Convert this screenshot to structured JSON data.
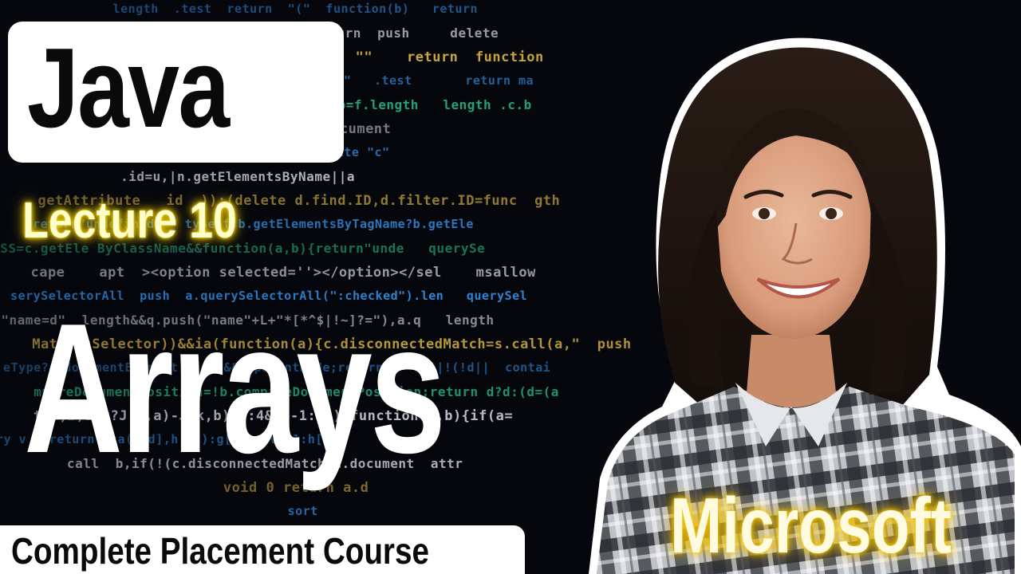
{
  "thumbnail": {
    "title": "Java",
    "lecture": "Lecture 10",
    "topic": "Arrays",
    "course": "Complete Placement Course",
    "company": "Microsoft"
  },
  "background": {
    "code_lines": [
      "                  length  .test  return  \"(\"  function(b)   return  ",
      "   },(                function  b  \"  return  push     delete  ",
      "                 split  \"(\"  length while  \"\"    return  function",
      "                 toLowerCase   return\"input\"   .test       return ma",
      "                   \"  \"  e      length  a,b=f.length   length .c.b",
      "                    var  b,e,g=a?a.ownerDocument    ",
      "                 className  \"i\" a.getAttribute \"c\"   ",
      "                .id=u,|n.getElementsByName||a  ",
      "  getAttribute   id  )):(delete d.find.ID,d.filter.ID=func  gth",
      "    return\"undefined\"   typeof b.getElementsByTagName?b.getEle  ",
      "  SS=c.getEle ByClassName&&function(a,b){return\"unde   querySe",
      "  cape    apt  ><option selected=''></option></sel    msallow",
      "  serySelectorAll  push  a.querySelectorAll(\":checked\").len   querySel",
      "   \"name=d\"  length&&q.push(\"name\"+L+\"*[*^$|!~]?=\"),a.q   length",
      "   MatchesSelector))&&ia(function(a){c.disconnectedMatch=s.call(a,\"  push",
      "  eType?a documentElement:a,d=b&&b.parentNode;return a===d||!(!d||  contai",
      "  mpareDocumentPosition=!b.compareDocumentPosition;return d?d:(d=(a  ",
      "    t(v,b)1:k?J(k,a)-J(k,b):0:4&d?-1:1));function(a,b){if(a=  ",
      "  ry v   return  ka(g[d],h[d]):g[d]===v?-1:h[d]  ",
      "       call  b,if(!(c.disconnectedMatch a.document  attr",
      "                           void 0 return a.d  ",
      "                                   sort  ",
      "                                    ",
      "                                         "
    ]
  },
  "colors": {
    "accent_glow": "#f2c400",
    "card_bg": "#ffffff",
    "title_text": "#0a0a0a",
    "code_blue": "#3aa0ff",
    "code_yellow": "#f2c94c",
    "code_white": "#dfe6f0",
    "code_green": "#2fd6a0"
  },
  "image": {
    "portrait": "smiling young woman with long dark hair in a grey plaid shirt"
  }
}
